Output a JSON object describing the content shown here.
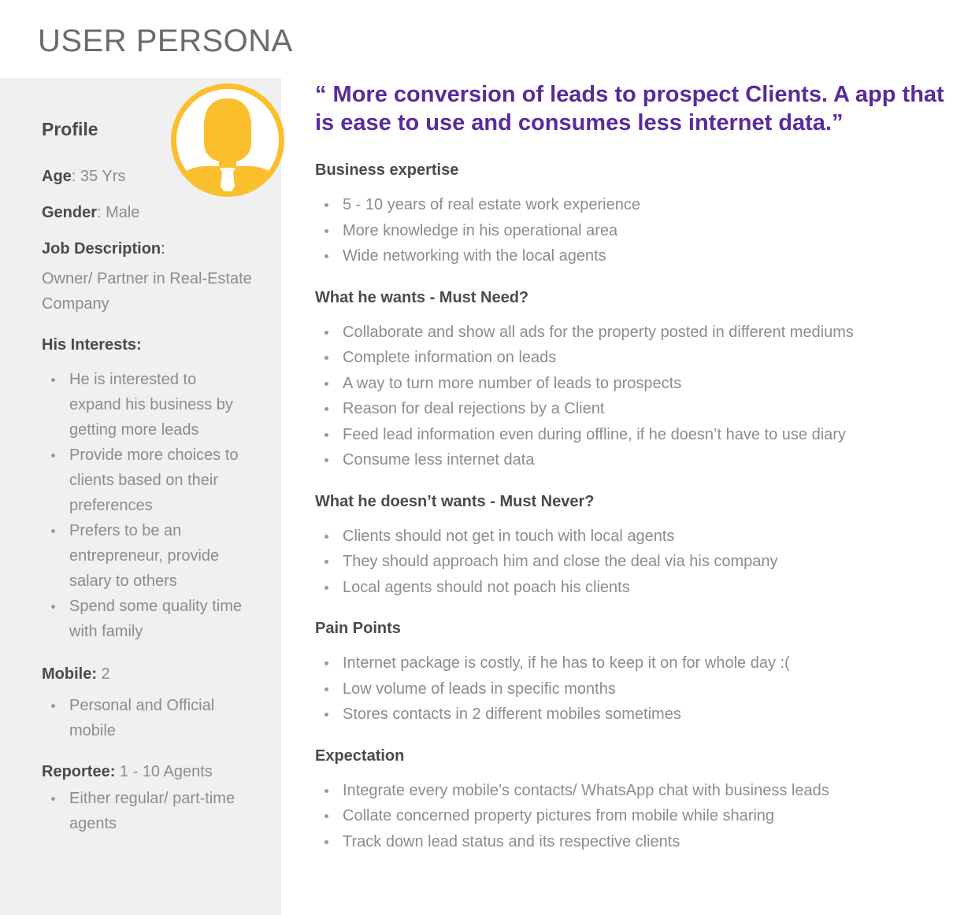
{
  "page_title": "USER PERSONA",
  "profile": {
    "heading": "Profile",
    "age_label": "Age",
    "age_value": ": 35 Yrs",
    "gender_label": "Gender",
    "gender_value": ": Male",
    "job_label": "Job Description",
    "job_colon": ":",
    "job_value": "Owner/ Partner in Real-Estate Company",
    "interests_heading": "His Interests:",
    "interests": [
      "He is interested to expand his business by getting more leads",
      "Provide more choices to clients based on their preferences",
      "Prefers to be an entrepreneur, provide salary to others",
      "Spend some quality time with family"
    ],
    "mobile_label": "Mobile:",
    "mobile_value": " 2",
    "mobile_items": [
      "Personal and Official mobile"
    ],
    "reportee_label": "Reportee:",
    "reportee_value": " 1 - 10 Agents",
    "reportee_items": [
      "Either regular/ part-time agents"
    ]
  },
  "avatar": {
    "icon": "user-avatar-icon",
    "ring_color": "#fbbf2d",
    "inner_color": "#ffffff"
  },
  "quote": "“ More conversion of leads to prospect Clients. A app that is ease to use and consumes less internet data.”",
  "colors": {
    "quote": "#5a2a9c",
    "sidebar_bg": "#f0f0f0",
    "heading": "#4a4a4a",
    "body_text": "#8c8c8c"
  },
  "sections": [
    {
      "heading": "Business expertise",
      "items": [
        "5 - 10 years of real estate work experience",
        "More knowledge in his operational area",
        "Wide networking with the local agents"
      ]
    },
    {
      "heading": "What he wants - Must Need?",
      "items": [
        "Collaborate and show all ads for the property posted in different mediums",
        "Complete information on leads",
        "A way to turn more number of leads to prospects",
        "Reason for deal rejections by a Client",
        "Feed lead information even during offline, if he doesn’t have to use diary",
        "Consume less internet data"
      ]
    },
    {
      "heading": "What he doesn’t wants - Must Never?",
      "items": [
        "Clients should not get in touch with local agents",
        "They should approach him and close the deal via his company",
        "Local agents should not poach his clients"
      ]
    },
    {
      "heading": "Pain Points",
      "items": [
        "Internet package is costly, if he has to keep it on for whole day :(",
        "Low volume of leads in specific months",
        "Stores contacts in 2 different mobiles sometimes"
      ]
    },
    {
      "heading": "Expectation",
      "items": [
        "Integrate every mobile’s contacts/ WhatsApp chat with business leads",
        "Collate concerned property pictures from mobile while sharing",
        "Track down lead status and its respective clients"
      ]
    }
  ]
}
